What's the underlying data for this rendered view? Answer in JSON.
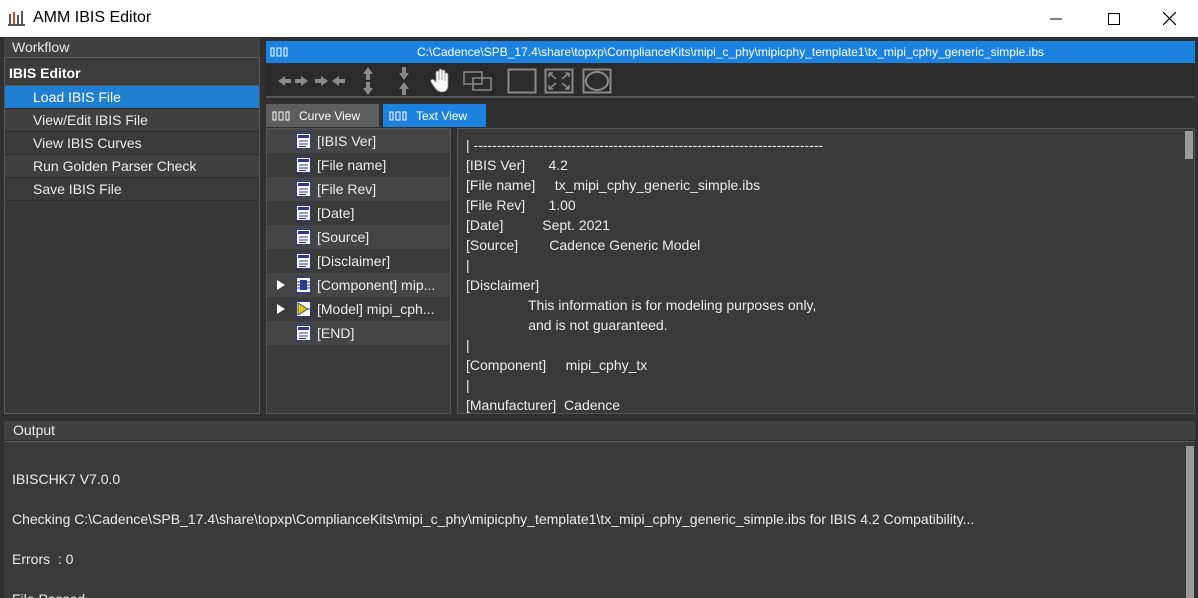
{
  "window": {
    "title": "AMM IBIS Editor",
    "controls": [
      "minimize-icon",
      "maximize-icon",
      "close-icon"
    ]
  },
  "workflow": {
    "header": "Workflow",
    "section_title": "IBIS Editor",
    "items": [
      {
        "label": "Load IBIS File",
        "selected": true
      },
      {
        "label": "View/Edit IBIS File",
        "selected": false
      },
      {
        "label": "View IBIS Curves",
        "selected": false
      },
      {
        "label": "Run Golden Parser Check",
        "selected": false
      },
      {
        "label": "Save IBIS File",
        "selected": false
      }
    ]
  },
  "file_window": {
    "path": "C:\\Cadence\\SPB_17.4\\share\\topxp\\ComplianceKits\\mipi_c_phy\\mipicphy_template1\\tx_mipi_cphy_generic_simple.ibs",
    "toolbar": [
      "pan-horizontal-icon",
      "zoom-in-horizontal-icon",
      "pan-vertical-icon",
      "zoom-in-vertical-icon",
      "hand-icon",
      "zoom-box-icon",
      "fit-icon",
      "zoom-extents-icon",
      "reset-view-icon"
    ],
    "tabs": [
      {
        "label": "Curve View",
        "active": false
      },
      {
        "label": "Text View",
        "active": true
      }
    ]
  },
  "tree": [
    {
      "label": "[IBIS Ver]",
      "expandable": false,
      "icon": "document-icon"
    },
    {
      "label": "[File name]",
      "expandable": false,
      "icon": "document-icon"
    },
    {
      "label": "[File Rev]",
      "expandable": false,
      "icon": "document-icon"
    },
    {
      "label": "[Date]",
      "expandable": false,
      "icon": "document-icon"
    },
    {
      "label": "[Source]",
      "expandable": false,
      "icon": "document-icon"
    },
    {
      "label": "[Disclaimer]",
      "expandable": false,
      "icon": "document-icon"
    },
    {
      "label": "[Component] mip...",
      "expandable": true,
      "icon": "component-icon"
    },
    {
      "label": "[Model] mipi_cph...",
      "expandable": true,
      "icon": "model-icon"
    },
    {
      "label": "[END]",
      "expandable": false,
      "icon": "document-icon"
    }
  ],
  "text_view": [
    "| ---------------------------------------------------------------------------",
    "[IBIS Ver]      4.2",
    "[File name]     tx_mipi_cphy_generic_simple.ibs",
    "[File Rev]      1.00",
    "[Date]          Sept. 2021",
    "[Source]        Cadence Generic Model",
    "|",
    "[Disclaimer]",
    "                This information is for modeling purposes only,",
    "                and is not guaranteed.",
    "|",
    "[Component]     mipi_cphy_tx",
    "|",
    "[Manufacturer]  Cadence"
  ],
  "output": {
    "header": "Output",
    "lines": [
      "IBISCHK7 V7.0.0",
      "Checking C:\\Cadence\\SPB_17.4\\share\\topxp\\ComplianceKits\\mipi_c_phy\\mipicphy_template1\\tx_mipi_cphy_generic_simple.ibs for IBIS 4.2 Compatibility...",
      "Errors  : 0",
      "File Passed"
    ]
  },
  "colors": {
    "accent": "#1b82e0",
    "selected": "#1f7fd1",
    "panel_bg": "#3a3a3a",
    "text": "#ececec"
  }
}
